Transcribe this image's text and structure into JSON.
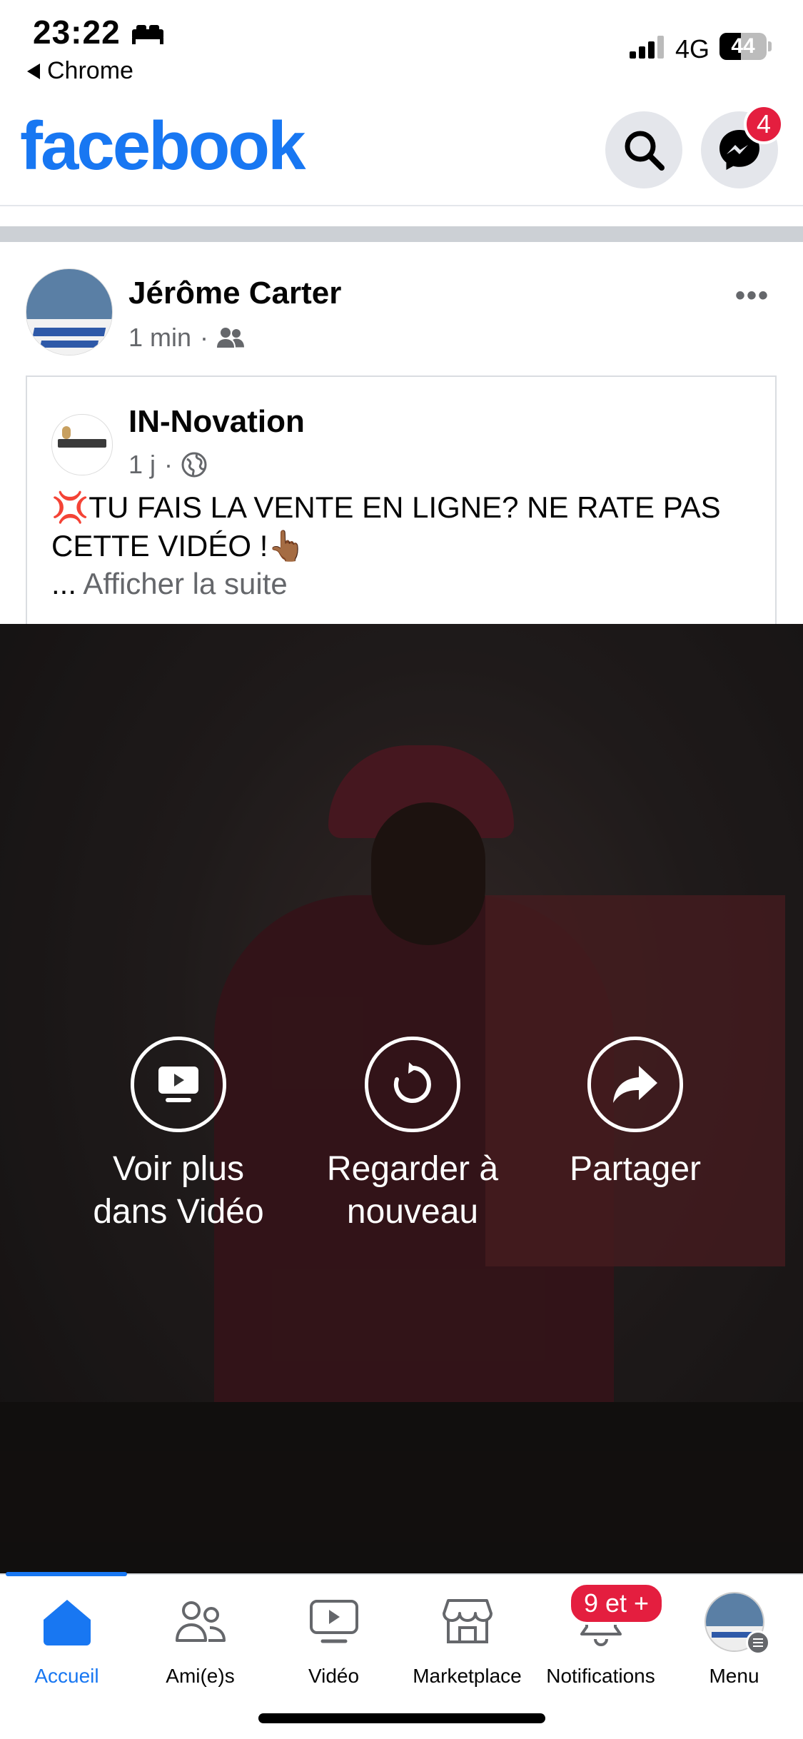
{
  "status_bar": {
    "time": "23:22",
    "back_app": "Chrome",
    "network": "4G",
    "battery": "44"
  },
  "header": {
    "logo": "facebook",
    "messenger_badge": "4"
  },
  "post": {
    "author": "Jérôme Carter",
    "time": "1 min",
    "audience_icon": "friends-icon",
    "shared": {
      "page_name": "IN-Novation",
      "time": "1 j",
      "audience_icon": "globe-icon",
      "text_emoji": "💢",
      "text": "TU FAIS LA VENTE EN LIGNE? NE RATE PAS CETTE VIDÉO !",
      "text_emoji_end": "👆🏾",
      "see_more_ellipsis": "...",
      "see_more": "Afficher la suite"
    }
  },
  "video_actions": [
    {
      "label_line1": "Voir plus",
      "label_line2": "dans Vidéo",
      "icon": "video-tv-icon"
    },
    {
      "label_line1": "Regarder à",
      "label_line2": "nouveau",
      "icon": "replay-icon"
    },
    {
      "label_line1": "Partager",
      "label_line2": "",
      "icon": "share-icon"
    }
  ],
  "bottom_nav": {
    "items": [
      {
        "label": "Accueil",
        "icon": "home-icon",
        "active": true
      },
      {
        "label": "Ami(e)s",
        "icon": "friends-icon"
      },
      {
        "label": "Vidéo",
        "icon": "video-icon"
      },
      {
        "label": "Marketplace",
        "icon": "marketplace-icon"
      },
      {
        "label": "Notifications",
        "icon": "bell-icon",
        "badge": "9 et +"
      },
      {
        "label": "Menu",
        "icon": "profile-menu-icon"
      }
    ]
  },
  "colors": {
    "brand": "#1877f2",
    "badge": "#e41e3f",
    "secondary_text": "#65676b"
  }
}
